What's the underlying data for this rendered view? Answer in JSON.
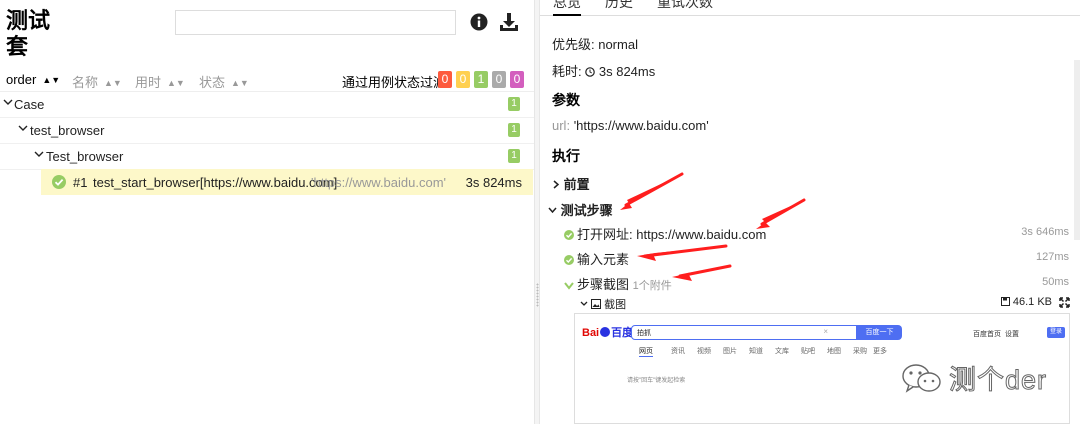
{
  "left": {
    "title": "测试套",
    "search_placeholder": "",
    "sort_columns": [
      {
        "label": "order",
        "active": true
      },
      {
        "label": "名称",
        "active": false
      },
      {
        "label": "用时",
        "active": false
      },
      {
        "label": "状态",
        "active": false
      }
    ],
    "filter_label": "通过用例状态过滤:",
    "filter_badges": [
      {
        "value": "0",
        "color": "#fd5a3e"
      },
      {
        "value": "0",
        "color": "#ffd050"
      },
      {
        "value": "1",
        "color": "#97cc64"
      },
      {
        "value": "0",
        "color": "#aaaaaa"
      },
      {
        "value": "0",
        "color": "#d35ebe"
      }
    ],
    "tree": [
      {
        "label": "Case",
        "count": "1"
      },
      {
        "label": "test_browser",
        "count": "1"
      },
      {
        "label": "Test_browser",
        "count": "1"
      }
    ],
    "case": {
      "number": "#1",
      "name": "test_start_browser[https://www.baidu.com]",
      "param": "'https://www.baidu.com'",
      "duration": "3s 824ms"
    }
  },
  "right": {
    "tabs": [
      "总览",
      "历史",
      "重试次数"
    ],
    "priority": "优先级: normal",
    "duration_label": "耗时:",
    "duration_value": "3s 824ms",
    "params_heading": "参数",
    "param_key": "url:",
    "param_value": "'https://www.baidu.com'",
    "exec_heading": "执行",
    "setup_label": "前置",
    "steps_label": "测试步骤",
    "steps": [
      {
        "label": "打开网址:",
        "value": "https://www.baidu.com",
        "duration": "3s 646ms"
      },
      {
        "label": "输入元素",
        "value": "",
        "duration": "127ms"
      },
      {
        "label": "步骤截图",
        "value": "1个附件",
        "duration": "50ms"
      }
    ],
    "attachment": {
      "name": "截图",
      "size": "46.1 KB"
    },
    "screenshot": {
      "logo_left": "Bai",
      "logo_right": "百度",
      "search_value": "拍抓",
      "clear": "×",
      "button": "百度一下",
      "top_links": [
        "百度首页",
        "设置"
      ],
      "login": "登录",
      "tabs": [
        "网页",
        "资讯",
        "视频",
        "图片",
        "知道",
        "文库",
        "贴吧",
        "地图",
        "采购",
        "更多"
      ],
      "empty_hint": "请按\"回车\"键发起检索"
    }
  },
  "watermark": "测个der",
  "colors": {
    "passed": "#97cc64",
    "arrow": "#ff1e1e",
    "highlight": "#fdf8c9"
  }
}
